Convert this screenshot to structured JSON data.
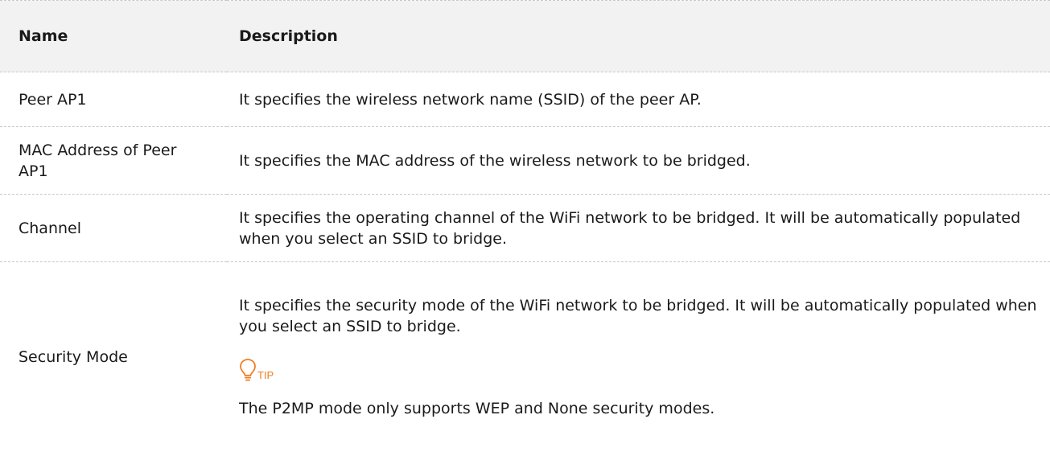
{
  "table": {
    "headers": {
      "name": "Name",
      "description": "Description"
    },
    "rows": [
      {
        "name": "Peer AP1",
        "description": "It specifies the wireless network name (SSID) of the peer AP."
      },
      {
        "name": "MAC Address of Peer AP1",
        "description": "It specifies the MAC address of the wireless network to be bridged."
      },
      {
        "name": "Channel",
        "description": "It specifies the operating channel of the WiFi network to be bridged. It will be automatically populated when you select an SSID to bridge."
      },
      {
        "name": "Security Mode",
        "description": "It specifies the security mode of the WiFi network to be bridged. It will be automatically populated when you select an SSID to bridge.",
        "tip_label": "TIP",
        "tip_text": "The P2MP mode only supports WEP and None security modes."
      }
    ]
  },
  "colors": {
    "accent": "#f07d22",
    "header_bg": "#f2f2f2",
    "divider": "#c8c8c8"
  },
  "icons": {
    "tip": "lightbulb-icon"
  }
}
